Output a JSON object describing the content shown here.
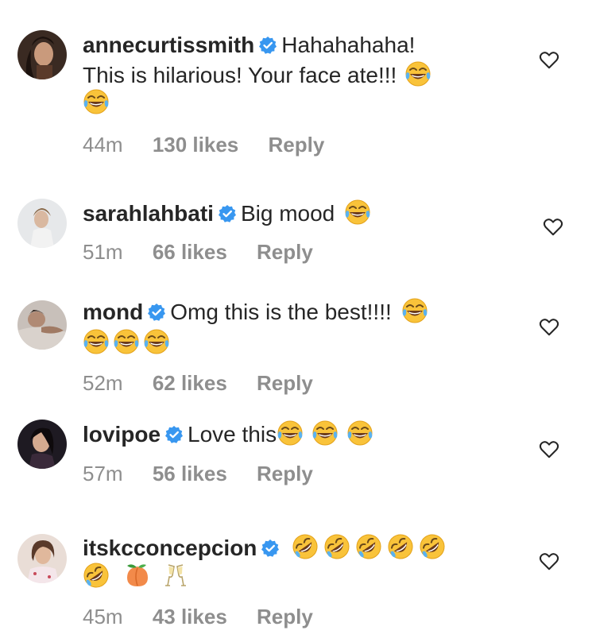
{
  "comments": [
    {
      "username": "annecurtissmith",
      "text_line1": "Hahahahaha!",
      "text_line2": "This is hilarious! Your face ate!!!",
      "time": "44m",
      "likes": "130 likes",
      "reply": "Reply"
    },
    {
      "username": "sarahlahbati",
      "text_line1": "Big mood",
      "time": "51m",
      "likes": "66 likes",
      "reply": "Reply"
    },
    {
      "username": "mond",
      "text_line1": "Omg this is the best!!!!",
      "time": "52m",
      "likes": "62 likes",
      "reply": "Reply"
    },
    {
      "username": "lovipoe",
      "text_line1": "Love this",
      "time": "57m",
      "likes": "56 likes",
      "reply": "Reply"
    },
    {
      "username": "itskcconcepcion",
      "time": "45m",
      "likes": "43 likes",
      "reply": "Reply"
    }
  ],
  "colors": {
    "verified": "#3897f0",
    "meta": "#8e8e8e",
    "text": "#262626"
  },
  "icons": {
    "verified": "verified-badge-icon",
    "like": "heart-outline-icon",
    "laugh": "face-with-tears-of-joy-icon",
    "rofl": "rolling-on-floor-laughing-icon",
    "peach": "peach-icon",
    "champagne": "clinking-glasses-icon"
  }
}
